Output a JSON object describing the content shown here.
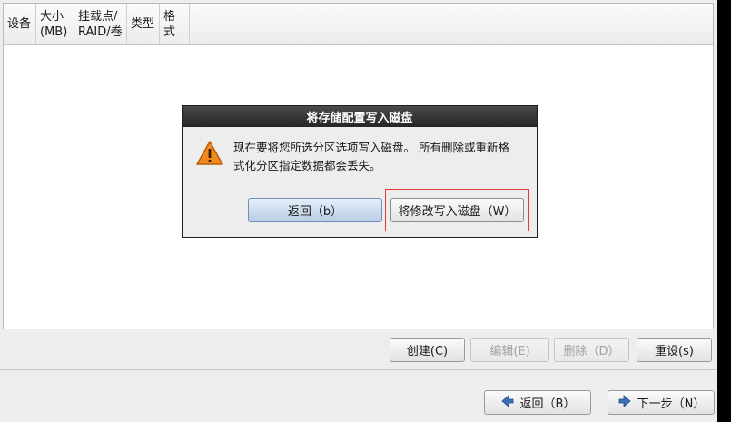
{
  "table": {
    "columns": [
      "设备",
      "大小\n(MB)",
      "挂载点/\nRAID/卷",
      "类型",
      "格式"
    ]
  },
  "dialog": {
    "title": "将存储配置写入磁盘",
    "message": "现在要将您所选分区选项写入磁盘。  所有删除或重新格\n式化分区指定数据都会丢失。",
    "back_label": "返回（b）",
    "write_label": "将修改写入磁盘（W）"
  },
  "actions": {
    "create": "创建(C)",
    "edit": "编辑(E)",
    "delete": "删除（D）",
    "reset": "重设(s)"
  },
  "nav": {
    "back": "返回（B）",
    "next": "下一步（N）"
  },
  "colors": {
    "highlight": "#e23a3a",
    "warning": "#f08a1c",
    "nav_arrow": "#3b6fb6"
  },
  "icons": [
    "warning-icon",
    "back-arrow-icon",
    "next-arrow-icon"
  ]
}
